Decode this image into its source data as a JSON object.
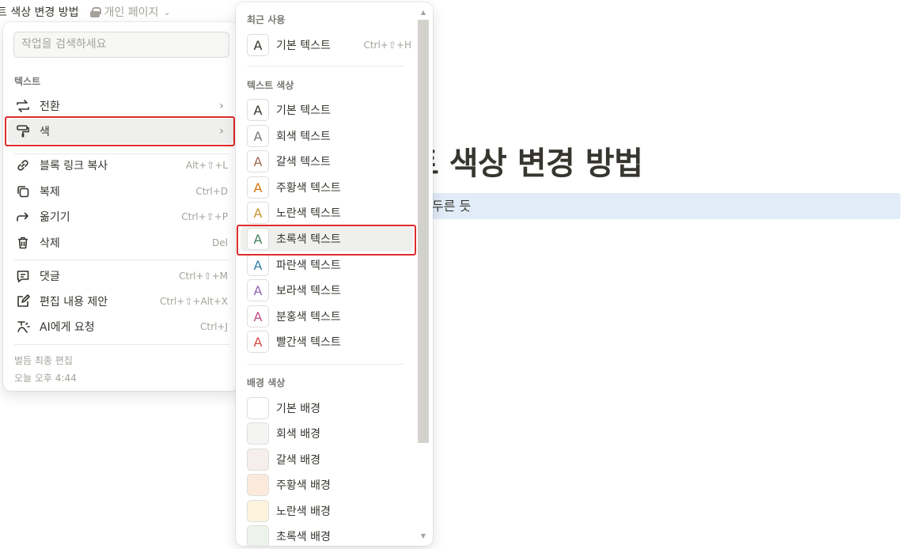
{
  "topbar": {
    "title": "트 색상 변경 방법",
    "breadcrumb": "개인 페이지",
    "chevron": "⌄"
  },
  "page": {
    "heading": "트 색상 변경 방법",
    "block_text": "두른 듯"
  },
  "menu": {
    "search_placeholder": "작업을 검색하세요",
    "section_text": "텍스트",
    "items": [
      {
        "label": "전환",
        "shortcut": "",
        "arrow": "›",
        "icon": "turn-into-icon"
      },
      {
        "label": "색",
        "shortcut": "",
        "arrow": "›",
        "icon": "paint-roller-icon"
      },
      {
        "label": "블록 링크 복사",
        "shortcut": "Alt+⇧+L",
        "icon": "link-icon"
      },
      {
        "label": "복제",
        "shortcut": "Ctrl+D",
        "icon": "duplicate-icon"
      },
      {
        "label": "옮기기",
        "shortcut": "Ctrl+⇧+P",
        "icon": "move-to-icon"
      },
      {
        "label": "삭제",
        "shortcut": "Del",
        "icon": "trash-icon"
      },
      {
        "label": "댓글",
        "shortcut": "Ctrl+⇧+M",
        "icon": "comment-icon"
      },
      {
        "label": "편집 내용 제안",
        "shortcut": "Ctrl+⇧+Alt+X",
        "icon": "suggest-edit-icon"
      },
      {
        "label": "AI에게 요청",
        "shortcut": "Ctrl+J",
        "icon": "ai-icon"
      }
    ],
    "footer_line1": "벌듬 최종 편집",
    "footer_line2": "오늘 오후 4:44"
  },
  "submenu": {
    "recent_label": "최근 사용",
    "recent_item": {
      "label": "기본 텍스트",
      "shortcut": "Ctrl+⇧+H",
      "glyph": "A",
      "color": "#37352f"
    },
    "text_color_label": "텍스트 색상",
    "text_colors": [
      {
        "label": "기본 텍스트",
        "glyph": "A",
        "color": "#37352f"
      },
      {
        "label": "회색 텍스트",
        "glyph": "A",
        "color": "#787774"
      },
      {
        "label": "갈색 텍스트",
        "glyph": "A",
        "color": "#9f6b53"
      },
      {
        "label": "주황색 텍스트",
        "glyph": "A",
        "color": "#d9730d"
      },
      {
        "label": "노란색 텍스트",
        "glyph": "A",
        "color": "#cb912f"
      },
      {
        "label": "초록색 텍스트",
        "glyph": "A",
        "color": "#448361"
      },
      {
        "label": "파란색 텍스트",
        "glyph": "A",
        "color": "#337ea9"
      },
      {
        "label": "보라색 텍스트",
        "glyph": "A",
        "color": "#9065b0"
      },
      {
        "label": "분홍색 텍스트",
        "glyph": "A",
        "color": "#c14c8a"
      },
      {
        "label": "빨간색 텍스트",
        "glyph": "A",
        "color": "#d44c47"
      }
    ],
    "bg_color_label": "배경 색상",
    "bg_colors": [
      {
        "label": "기본 배경",
        "color": "#ffffff"
      },
      {
        "label": "회색 배경",
        "color": "#f4f4f2"
      },
      {
        "label": "갈색 배경",
        "color": "#f5eeec"
      },
      {
        "label": "주황색 배경",
        "color": "#fbeadb"
      },
      {
        "label": "노란색 배경",
        "color": "#fbf3db"
      },
      {
        "label": "초록색 배경",
        "color": "#edf3ec"
      }
    ]
  },
  "colors": {
    "highlight": "#e02b2b",
    "block_bg": "#e1ecf8"
  }
}
